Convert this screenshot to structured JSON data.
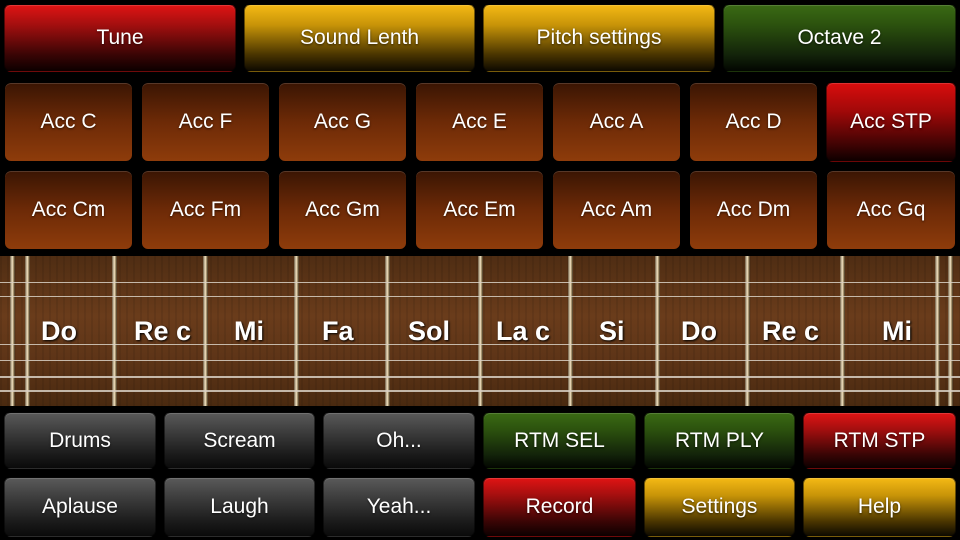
{
  "top_bar": [
    {
      "id": "tune",
      "label": "Tune",
      "color": "red"
    },
    {
      "id": "sound-length",
      "label": "Sound Lenth",
      "color": "yellow"
    },
    {
      "id": "pitch-settings",
      "label": "Pitch settings",
      "color": "yellow"
    },
    {
      "id": "octave",
      "label": "Octave 2",
      "color": "green"
    }
  ],
  "chords_major": [
    "Acc C",
    "Acc F",
    "Acc G",
    "Acc E",
    "Acc A",
    "Acc D",
    "Acc STP"
  ],
  "chords_minor": [
    "Acc Cm",
    "Acc Fm",
    "Acc Gm",
    "Acc Em",
    "Acc Am",
    "Acc Dm",
    "Acc Gq"
  ],
  "fretboard": {
    "notes": [
      "Do",
      "Re c",
      "Mi",
      "Fa",
      "Sol",
      "La c",
      "Si",
      "Do",
      "Re c",
      "Mi"
    ]
  },
  "bottom_row1": [
    {
      "id": "drums",
      "label": "Drums",
      "color": "gray"
    },
    {
      "id": "scream",
      "label": "Scream",
      "color": "gray"
    },
    {
      "id": "oh",
      "label": "Oh...",
      "color": "gray"
    },
    {
      "id": "rtm-sel",
      "label": "RTM SEL",
      "color": "green"
    },
    {
      "id": "rtm-ply",
      "label": "RTM PLY",
      "color": "green"
    },
    {
      "id": "rtm-stp",
      "label": "RTM STP",
      "color": "red"
    }
  ],
  "bottom_row2": [
    {
      "id": "aplause",
      "label": "Aplause",
      "color": "gray"
    },
    {
      "id": "laugh",
      "label": "Laugh",
      "color": "gray"
    },
    {
      "id": "yeah",
      "label": "Yeah...",
      "color": "gray"
    },
    {
      "id": "record",
      "label": "Record",
      "color": "red"
    },
    {
      "id": "settings",
      "label": "Settings",
      "color": "yellow"
    },
    {
      "id": "help",
      "label": "Help",
      "color": "yellow"
    }
  ]
}
